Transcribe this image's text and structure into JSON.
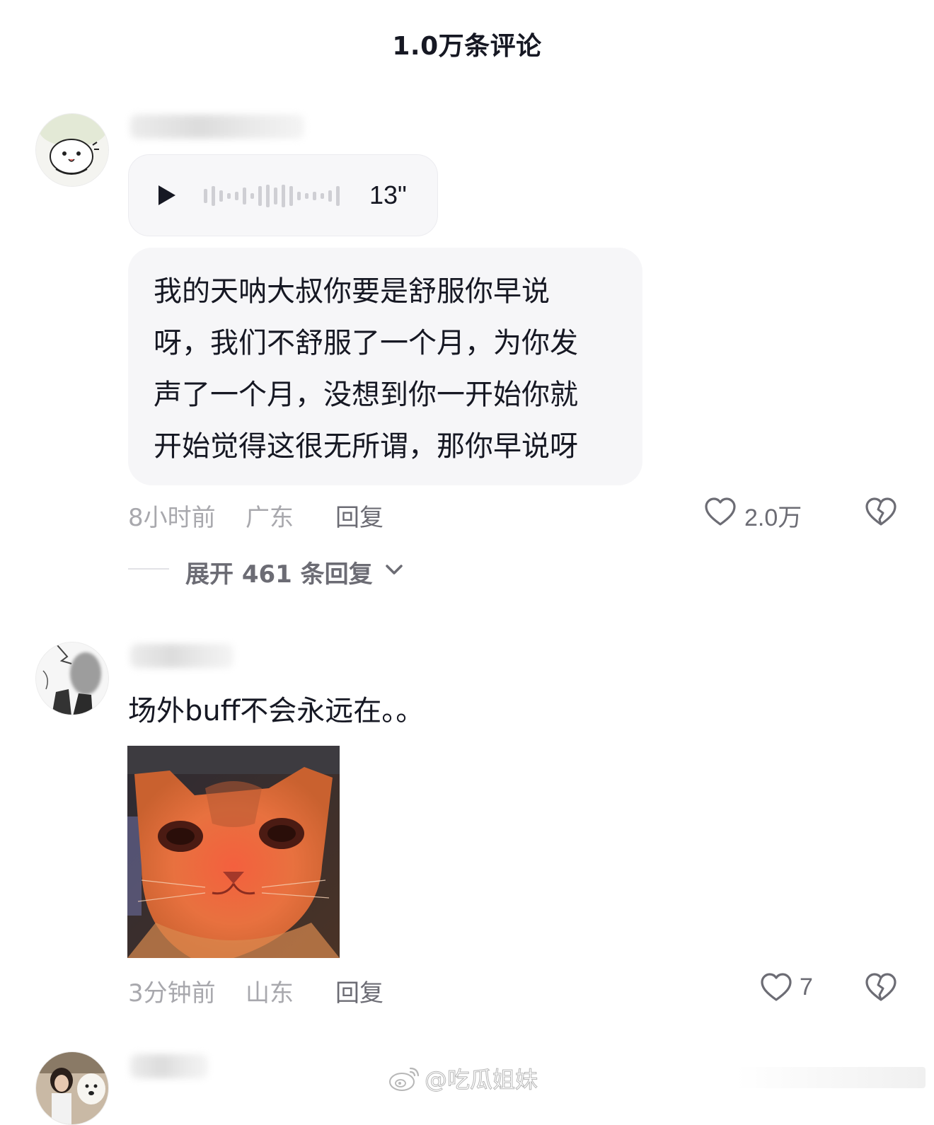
{
  "header": {
    "title": "1.0万条评论"
  },
  "comments": [
    {
      "voice": {
        "duration": "13\""
      },
      "text_lines": [
        "我的天呐大叔你要是舒服你早说",
        "呀，我们不舒服了一个月，为你发",
        "声了一个月，没想到你一开始你就",
        "开始觉得这很无所谓，那你早说呀"
      ],
      "time": "8小时前",
      "location": "广东",
      "reply_label": "回复",
      "likes": "2.0万",
      "expand_label": "展开 461 条回复"
    },
    {
      "text": "场外buff不会永远在。。",
      "time": "3分钟前",
      "location": "山东",
      "reply_label": "回复",
      "likes": "7"
    }
  ],
  "watermark": {
    "text": "@吃瓜姐妹",
    "icon": "weibo-logo-icon"
  },
  "colors": {
    "primary_text": "#161823",
    "secondary_text": "#6c6c74",
    "meta_text": "#a8a8ad",
    "bubble_bg": "#f6f6f8"
  }
}
